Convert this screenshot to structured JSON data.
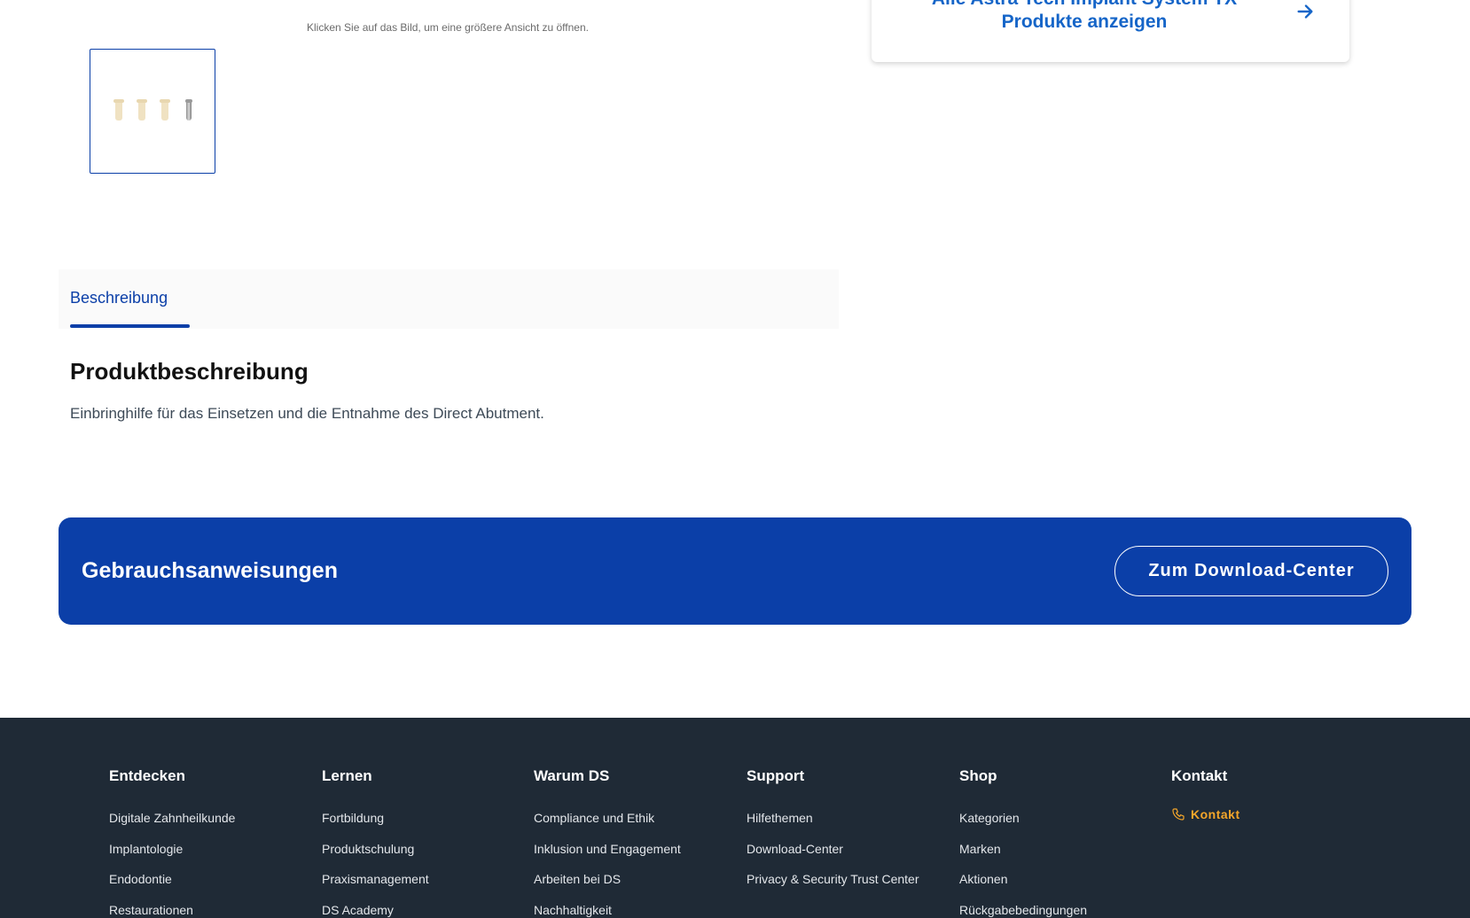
{
  "gallery": {
    "hint": "Klicken Sie auf das Bild, um eine größere Ansicht zu öffnen."
  },
  "related": {
    "link_text": "Alle Astra Tech Implant System TX Produkte anzeigen"
  },
  "tabs": [
    {
      "label": "Beschreibung",
      "active": true
    }
  ],
  "description": {
    "title": "Produktbeschreibung",
    "text": "Einbringhilfe für das Einsetzen und die Entnahme des Direct Abutment."
  },
  "banner": {
    "title": "Gebrauchsanweisungen",
    "button_label": "Zum Download-Center"
  },
  "footer": {
    "columns": [
      {
        "heading": "Entdecken",
        "links": [
          "Digitale Zahnheilkunde",
          "Implantologie",
          "Endodontie",
          "Restaurationen"
        ]
      },
      {
        "heading": "Lernen",
        "links": [
          "Fortbildung",
          "Produktschulung",
          "Praxismanagement",
          "DS Academy"
        ]
      },
      {
        "heading": "Warum DS",
        "links": [
          "Compliance und Ethik",
          "Inklusion und Engagement",
          "Arbeiten bei DS",
          "Nachhaltigkeit"
        ]
      },
      {
        "heading": "Support",
        "links": [
          "Hilfethemen",
          "Download-Center",
          "Privacy & Security Trust Center"
        ]
      },
      {
        "heading": "Shop",
        "links": [
          "Kategorien",
          "Marken",
          "Aktionen",
          "Rückgabebedingungen"
        ]
      },
      {
        "heading": "Kontakt",
        "contact_label": "Kontakt"
      }
    ]
  },
  "colors": {
    "brand_blue": "#0b3fa8",
    "link_blue": "#1565c8",
    "footer_bg": "#1f2a36",
    "accent_orange": "#f4a62a"
  },
  "icons": {
    "card_arrow": "arrow-right-icon",
    "contact": "phone-icon"
  }
}
